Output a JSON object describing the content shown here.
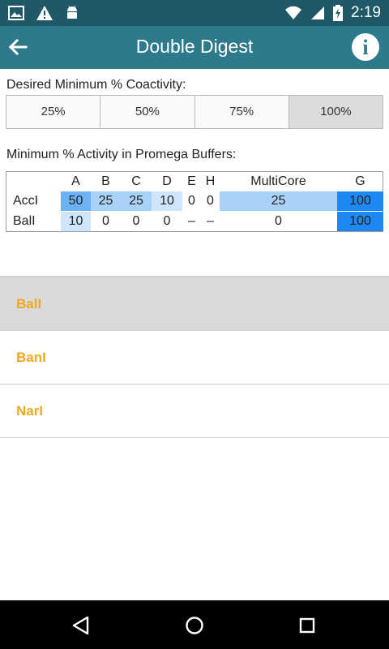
{
  "status_bar": {
    "time": "2:19",
    "icons": [
      "image-icon",
      "warning-icon",
      "android-icon",
      "wifi-icon",
      "signal-icon",
      "battery-charging-icon"
    ]
  },
  "app_bar": {
    "title": "Double Digest",
    "info_label": "i"
  },
  "coactivity": {
    "label": "Desired Minimum % Coactivity:",
    "options": [
      "25%",
      "50%",
      "75%",
      "100%"
    ],
    "selected": "100%"
  },
  "activity": {
    "label": "Minimum % Activity in Promega Buffers:",
    "columns": [
      "A",
      "B",
      "C",
      "D",
      "E",
      "H",
      "MultiCore",
      "G"
    ],
    "rows": [
      {
        "name": "AccI",
        "values": [
          "50",
          "25",
          "25",
          "10",
          "0",
          "0",
          "25",
          "100"
        ]
      },
      {
        "name": "BalI",
        "values": [
          "10",
          "0",
          "0",
          "0",
          "–",
          "–",
          "0",
          "100"
        ]
      }
    ],
    "colors": {
      "high": "#1e88f5",
      "mid": "#6cb3f5",
      "low": "#a9d2f8"
    }
  },
  "enzymes": {
    "items": [
      "BalI",
      "BanI",
      "NarI"
    ],
    "selected": "BalI",
    "text_color": "#f2a81d"
  },
  "nav_bar": {
    "buttons": [
      "back-triangle-icon",
      "home-circle-icon",
      "recents-square-icon"
    ]
  }
}
